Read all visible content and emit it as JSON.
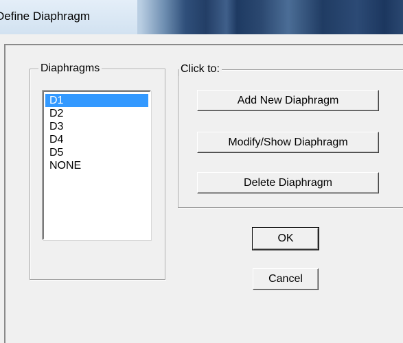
{
  "window": {
    "title": "Define Diaphragm"
  },
  "diaphragms_group": {
    "label": "Diaphragms",
    "items": [
      {
        "label": "D1",
        "selected": true
      },
      {
        "label": "D2",
        "selected": false
      },
      {
        "label": "D3",
        "selected": false
      },
      {
        "label": "D4",
        "selected": false
      },
      {
        "label": "D5",
        "selected": false
      },
      {
        "label": "NONE",
        "selected": false
      }
    ]
  },
  "click_to_group": {
    "label": "Click to:",
    "add_label": "Add New Diaphragm",
    "modify_label": "Modify/Show Diaphragm",
    "delete_label": "Delete Diaphragm"
  },
  "actions": {
    "ok_label": "OK",
    "cancel_label": "Cancel"
  },
  "colors": {
    "selection": "#3399ff",
    "dialog_bg": "#f0f0f0",
    "title_dark": "#233e66"
  }
}
